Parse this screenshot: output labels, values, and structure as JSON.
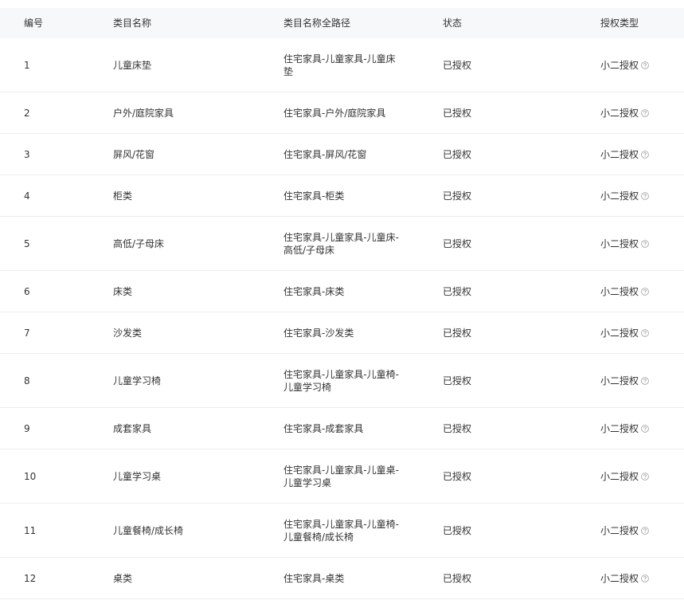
{
  "table": {
    "columns": [
      "编号",
      "类目名称",
      "类目名称全路径",
      "状态",
      "授权类型"
    ],
    "rows": [
      {
        "id": "1",
        "name": "儿童床垫",
        "path_lines": [
          "住宅家具-儿童家具-儿童床",
          "垫"
        ],
        "status": "已授权",
        "auth_type": "小二授权"
      },
      {
        "id": "2",
        "name": "户外/庭院家具",
        "path_lines": [
          "住宅家具-户外/庭院家具"
        ],
        "status": "已授权",
        "auth_type": "小二授权"
      },
      {
        "id": "3",
        "name": "屏风/花窗",
        "path_lines": [
          "住宅家具-屏风/花窗"
        ],
        "status": "已授权",
        "auth_type": "小二授权"
      },
      {
        "id": "4",
        "name": "柜类",
        "path_lines": [
          "住宅家具-柜类"
        ],
        "status": "已授权",
        "auth_type": "小二授权"
      },
      {
        "id": "5",
        "name": "高低/子母床",
        "path_lines": [
          "住宅家具-儿童家具-儿童床-",
          "高低/子母床"
        ],
        "status": "已授权",
        "auth_type": "小二授权"
      },
      {
        "id": "6",
        "name": "床类",
        "path_lines": [
          "住宅家具-床类"
        ],
        "status": "已授权",
        "auth_type": "小二授权"
      },
      {
        "id": "7",
        "name": "沙发类",
        "path_lines": [
          "住宅家具-沙发类"
        ],
        "status": "已授权",
        "auth_type": "小二授权"
      },
      {
        "id": "8",
        "name": "儿童学习椅",
        "path_lines": [
          "住宅家具-儿童家具-儿童椅-",
          "儿童学习椅"
        ],
        "status": "已授权",
        "auth_type": "小二授权"
      },
      {
        "id": "9",
        "name": "成套家具",
        "path_lines": [
          "住宅家具-成套家具"
        ],
        "status": "已授权",
        "auth_type": "小二授权"
      },
      {
        "id": "10",
        "name": "儿童学习桌",
        "path_lines": [
          "住宅家具-儿童家具-儿童桌-",
          "儿童学习桌"
        ],
        "status": "已授权",
        "auth_type": "小二授权"
      },
      {
        "id": "11",
        "name": "儿童餐椅/成长椅",
        "path_lines": [
          "住宅家具-儿童家具-儿童椅-",
          "儿童餐椅/成长椅"
        ],
        "status": "已授权",
        "auth_type": "小二授权"
      },
      {
        "id": "12",
        "name": "桌类",
        "path_lines": [
          "住宅家具-桌类"
        ],
        "status": "已授权",
        "auth_type": "小二授权"
      }
    ],
    "help_icon": "question-circle-icon",
    "colors": {
      "header_bg": "#f7f8fa",
      "row_border": "#eeeeee",
      "text": "#333333",
      "icon": "#999999"
    }
  }
}
